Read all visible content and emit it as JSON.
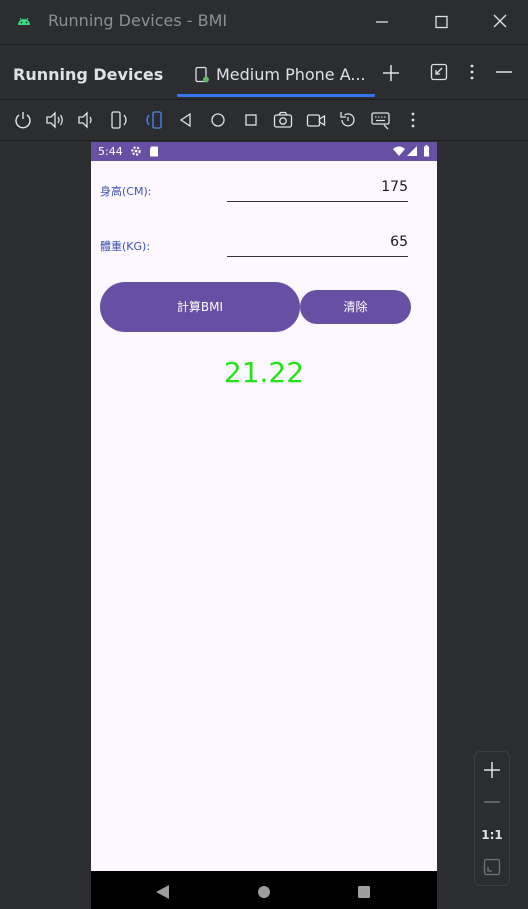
{
  "window": {
    "title": "Running Devices - BMI"
  },
  "tool_window": {
    "title": "Running Devices",
    "tab_label": "Medium Phone A...",
    "accent_color": "#3574f0"
  },
  "device": {
    "status_bar": {
      "time": "5:44"
    },
    "height_label": "身高(CM):",
    "height_value": "175",
    "weight_label": "體重(KG):",
    "weight_value": "65",
    "calc_button": "計算BMI",
    "clear_button": "清除",
    "result": "21.22",
    "accent_color": "#6750a4",
    "result_color": "#21e317"
  },
  "zoom_panel": {
    "reset_label": "1:1"
  }
}
